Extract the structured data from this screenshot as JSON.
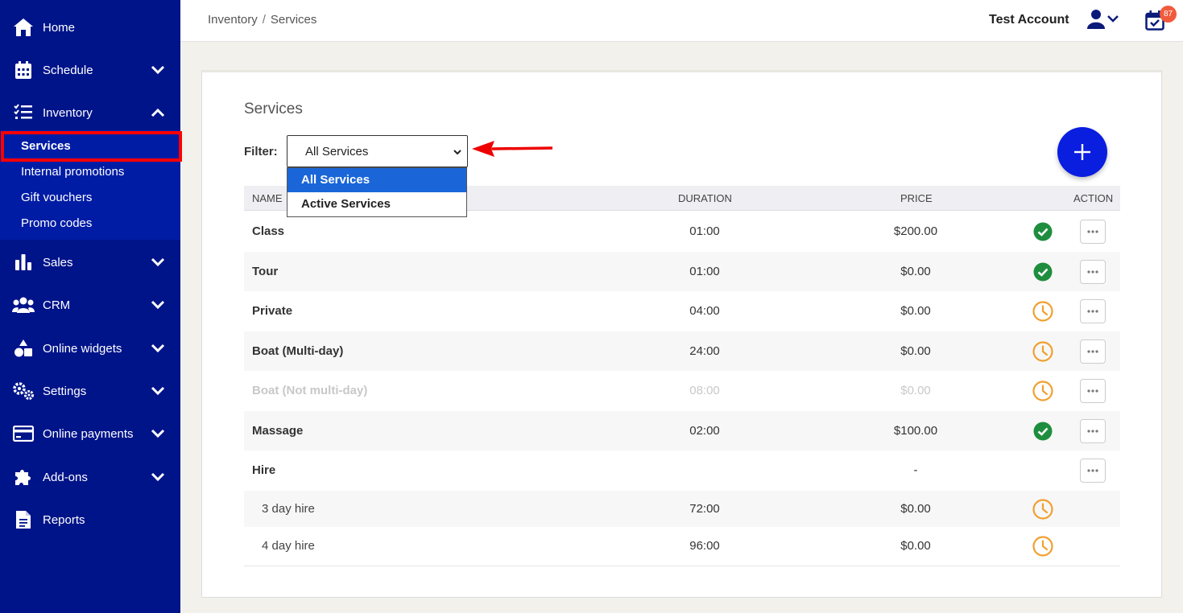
{
  "sidebar": {
    "items": [
      {
        "label": "Home",
        "icon": "home-icon"
      },
      {
        "label": "Schedule",
        "icon": "calendar-icon"
      },
      {
        "label": "Inventory",
        "icon": "checklist-icon"
      },
      {
        "label": "Sales",
        "icon": "bar-chart-icon"
      },
      {
        "label": "CRM",
        "icon": "users-icon"
      },
      {
        "label": "Online widgets",
        "icon": "shapes-icon"
      },
      {
        "label": "Settings",
        "icon": "gears-icon"
      },
      {
        "label": "Online payments",
        "icon": "credit-card-icon"
      },
      {
        "label": "Add-ons",
        "icon": "puzzle-icon"
      },
      {
        "label": "Reports",
        "icon": "document-icon"
      }
    ],
    "inventory_sub": [
      {
        "label": "Services",
        "active": true
      },
      {
        "label": "Internal promotions"
      },
      {
        "label": "Gift vouchers"
      },
      {
        "label": "Promo codes"
      }
    ]
  },
  "topbar": {
    "breadcrumb": [
      "Inventory",
      "Services"
    ],
    "breadcrumb_sep": "/",
    "account_name": "Test Account",
    "notification_count": "87"
  },
  "page": {
    "title": "Services",
    "filter_label": "Filter:",
    "filter_value": "All Services",
    "filter_options": [
      "All Services",
      "Active Services"
    ],
    "add_button": "+"
  },
  "table": {
    "headers": {
      "name": "NAME",
      "duration": "DURATION",
      "price": "PRICE",
      "action": "ACTION"
    },
    "rows": [
      {
        "name": "Class",
        "duration": "01:00",
        "price": "$200.00",
        "status": "active"
      },
      {
        "name": "Tour",
        "duration": "01:00",
        "price": "$0.00",
        "status": "active"
      },
      {
        "name": "Private",
        "duration": "04:00",
        "price": "$0.00",
        "status": "pending"
      },
      {
        "name": "Boat (Multi-day)",
        "duration": "24:00",
        "price": "$0.00",
        "status": "pending"
      },
      {
        "name": "Boat (Not multi-day)",
        "duration": "08:00",
        "price": "$0.00",
        "status": "pending"
      },
      {
        "name": "Massage",
        "duration": "02:00",
        "price": "$100.00",
        "status": "active"
      },
      {
        "name": "Hire",
        "duration": "",
        "price": "-",
        "status": ""
      },
      {
        "name": "3 day hire",
        "duration": "72:00",
        "price": "$0.00",
        "status": "pending"
      },
      {
        "name": "4 day hire",
        "duration": "96:00",
        "price": "$0.00",
        "status": "pending"
      }
    ]
  },
  "colors": {
    "sidebar_bg": "#00148a",
    "sidebar_sub_bg": "#001ca5",
    "accent_blue": "#0a1ee0",
    "select_highlight": "#1a66d8",
    "status_active": "#1e8e3e",
    "status_pending": "#f0a030",
    "annotation_red": "#ff0000",
    "badge": "#f15a3c"
  }
}
